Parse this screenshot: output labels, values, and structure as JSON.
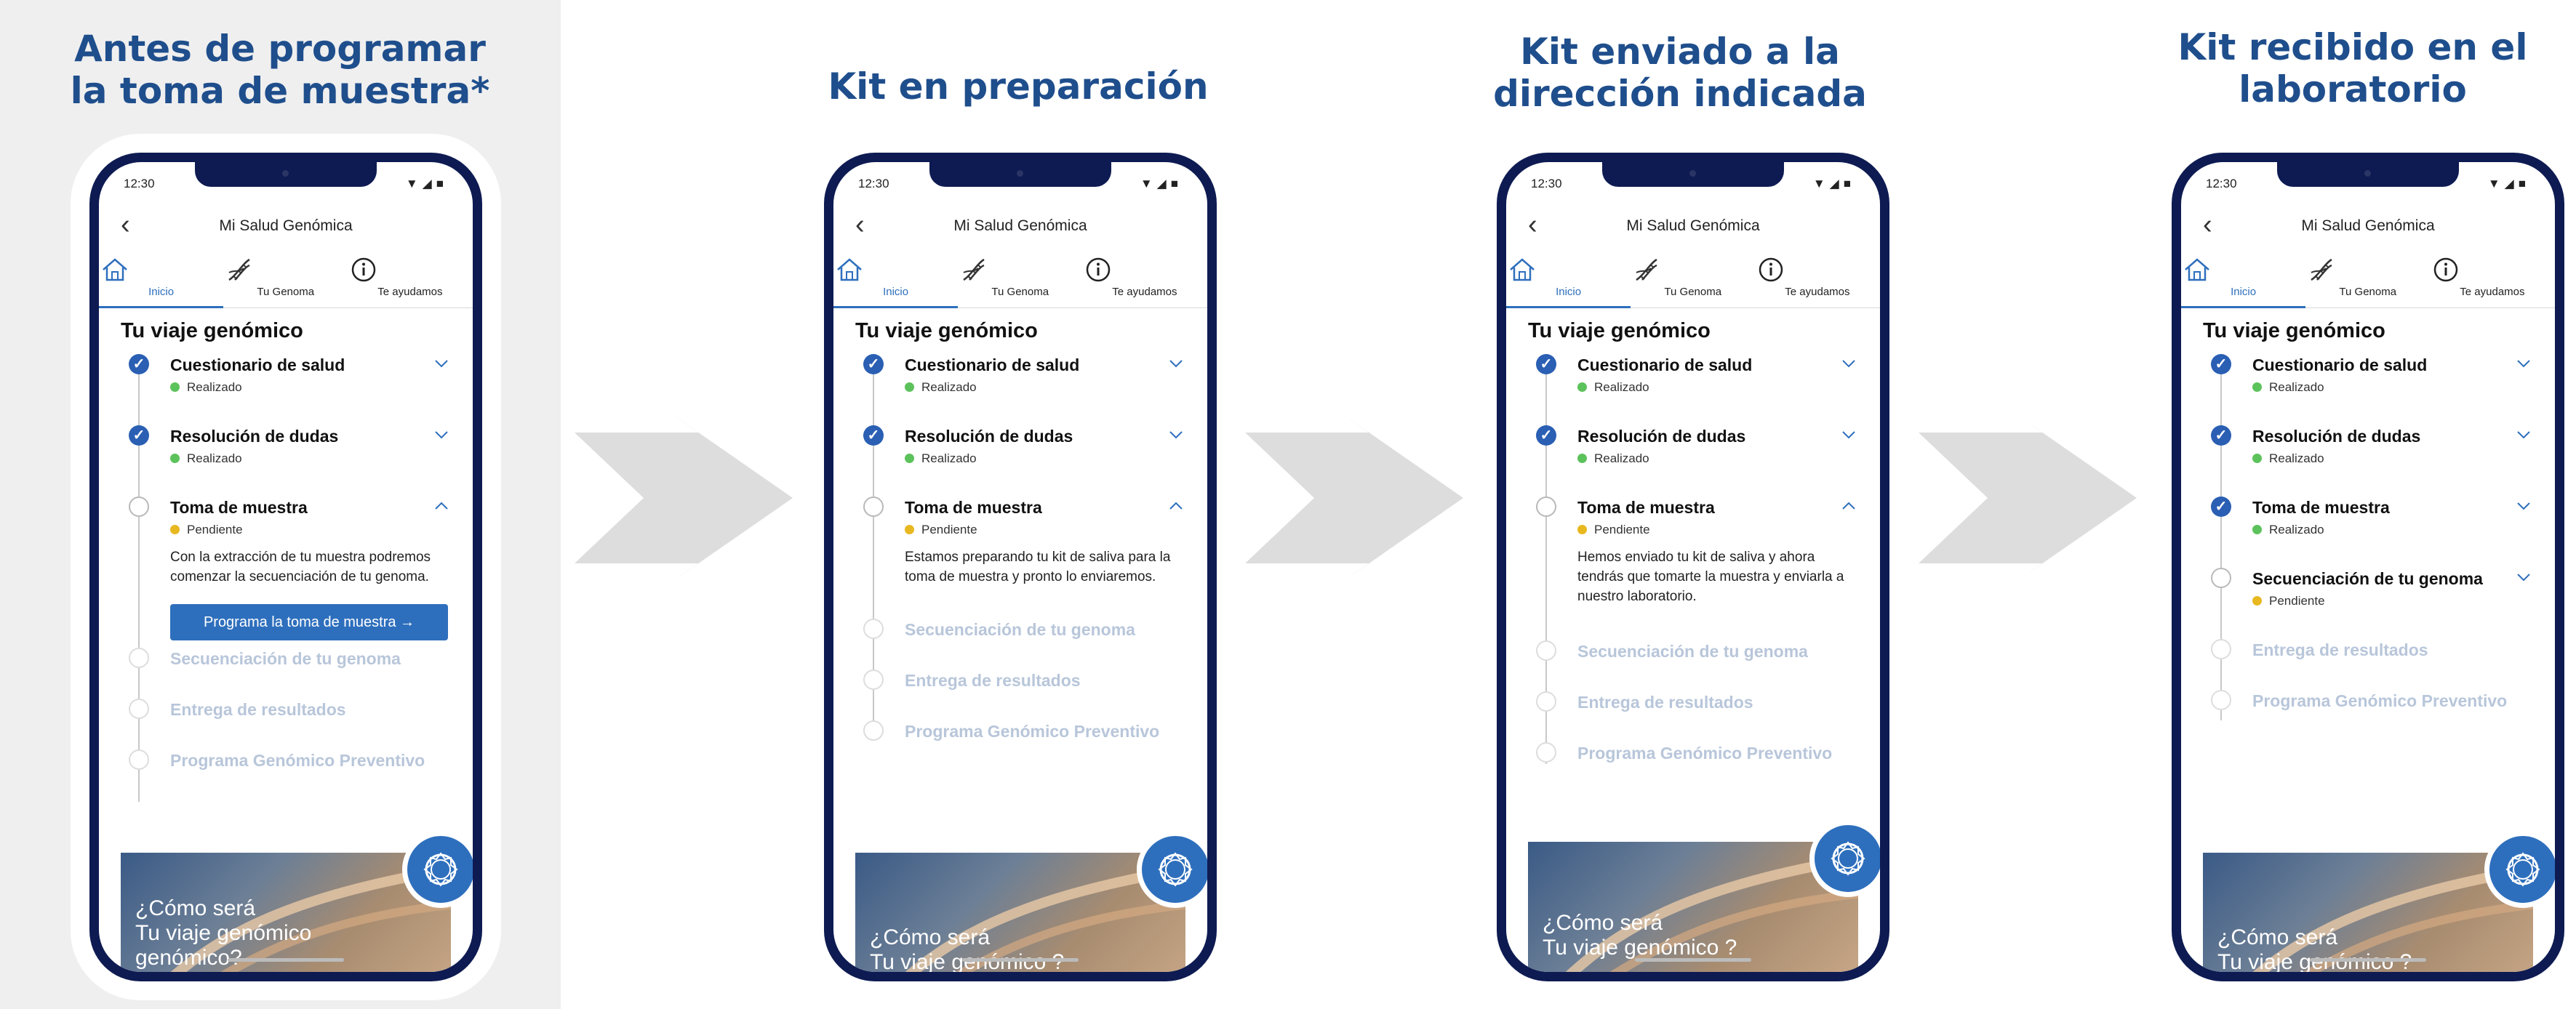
{
  "app_title": "Mi Salud Genómica",
  "status_time": "12:30",
  "tabs": [
    "Inicio",
    "Tu Genoma",
    "Te ayudamos"
  ],
  "journey_title": "Tu viaje genómico",
  "status_labels": {
    "done": "Realizado",
    "pending": "Pendiente"
  },
  "steps": [
    "Cuestionario de salud",
    "Resolución de dudas",
    "Toma de muestra",
    "Secuenciación de tu genoma",
    "Entrega de resultados",
    "Programa Genómico Preventivo"
  ],
  "colors": {
    "title": "#1f4e8c",
    "accent": "#2e6fbd",
    "done": "#5cc25b",
    "pending": "#e8b820",
    "frame": "#0e1b52"
  },
  "panels": [
    {
      "title_line1": "Antes de programar",
      "title_line2": "la toma de muestra*",
      "description": "Con la extracción de tu muestra podremos comenzar la secuenciación de tu genoma.",
      "cta_label": "Programa la toma de muestra →",
      "promo_line1": "¿Cómo será",
      "promo_line2": "Tu viaje genómico",
      "promo_line3": "genómico?"
    },
    {
      "title_line1": "Kit en preparación",
      "description": "Estamos preparando tu kit de saliva para la toma de muestra y pronto lo enviaremos.",
      "promo_line1": "¿Cómo será",
      "promo_line2": "Tu viaje genómico ?"
    },
    {
      "title_line1": "Kit enviado a la",
      "title_line2": "dirección indicada",
      "description": "Hemos enviado tu kit de saliva y ahora tendrás que tomarte la muestra y enviarla a nuestro laboratorio.",
      "promo_line1": "¿Cómo será",
      "promo_line2": "Tu viaje genómico ?"
    },
    {
      "title_line1": "Kit recibido en el",
      "title_line2": "laboratorio",
      "promo_line1": "¿Cómo será",
      "promo_line2": "Tu viaje genómico ?"
    }
  ]
}
